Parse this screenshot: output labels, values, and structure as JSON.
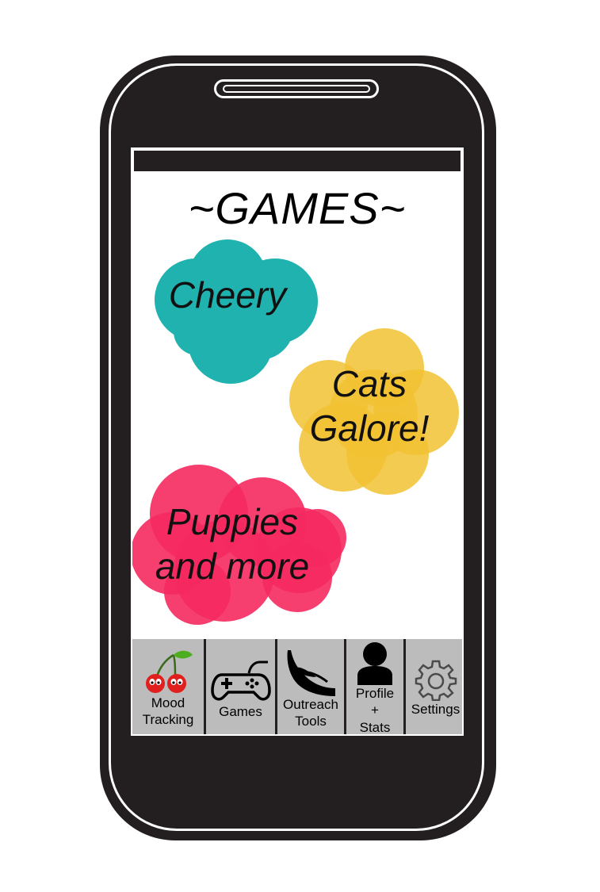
{
  "screen": {
    "title": "~GAMES~"
  },
  "games": [
    {
      "label": "Cheery",
      "color": "#20b2af"
    },
    {
      "label_line1": "Cats",
      "label_line2": "Galore!",
      "color": "#f2c233"
    },
    {
      "label_line1": "Puppies",
      "label_line2": "and more",
      "color": "#f5295f"
    }
  ],
  "nav": {
    "mood_line1": "Mood",
    "mood_line2": "Tracking",
    "games": "Games",
    "outreach_line1": "Outreach",
    "outreach_line2": "Tools",
    "profile_line1": "Profile",
    "profile_line2": "+",
    "profile_line3": "Stats",
    "settings": "Settings"
  },
  "icons": [
    "cherry-icon",
    "gamepad-icon",
    "hand-icon",
    "person-icon",
    "gear-icon"
  ]
}
